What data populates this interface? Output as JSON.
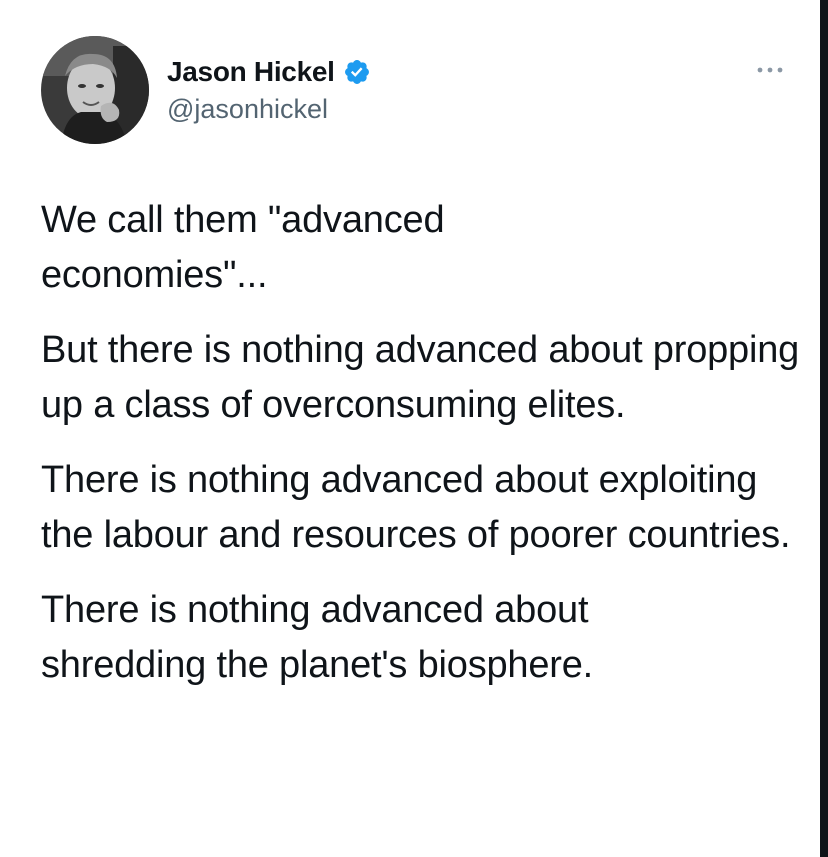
{
  "author": {
    "display_name": "Jason Hickel",
    "handle": "@jasonhickel",
    "verified": true
  },
  "more_icon": "more-horizontal-icon",
  "verified_icon": "verified-badge-icon",
  "colors": {
    "text": "#0f1419",
    "secondary": "#536471",
    "verified": "#1d9bf0"
  },
  "tweet": {
    "paragraphs": [
      "We call them \"advanced economies\"...",
      "But there is nothing advanced about propping up a class of overconsuming elites.",
      "There is nothing advanced about exploiting the labour and resources of poorer countries.",
      "There is nothing advanced about shredding the planet's biosphere."
    ]
  }
}
